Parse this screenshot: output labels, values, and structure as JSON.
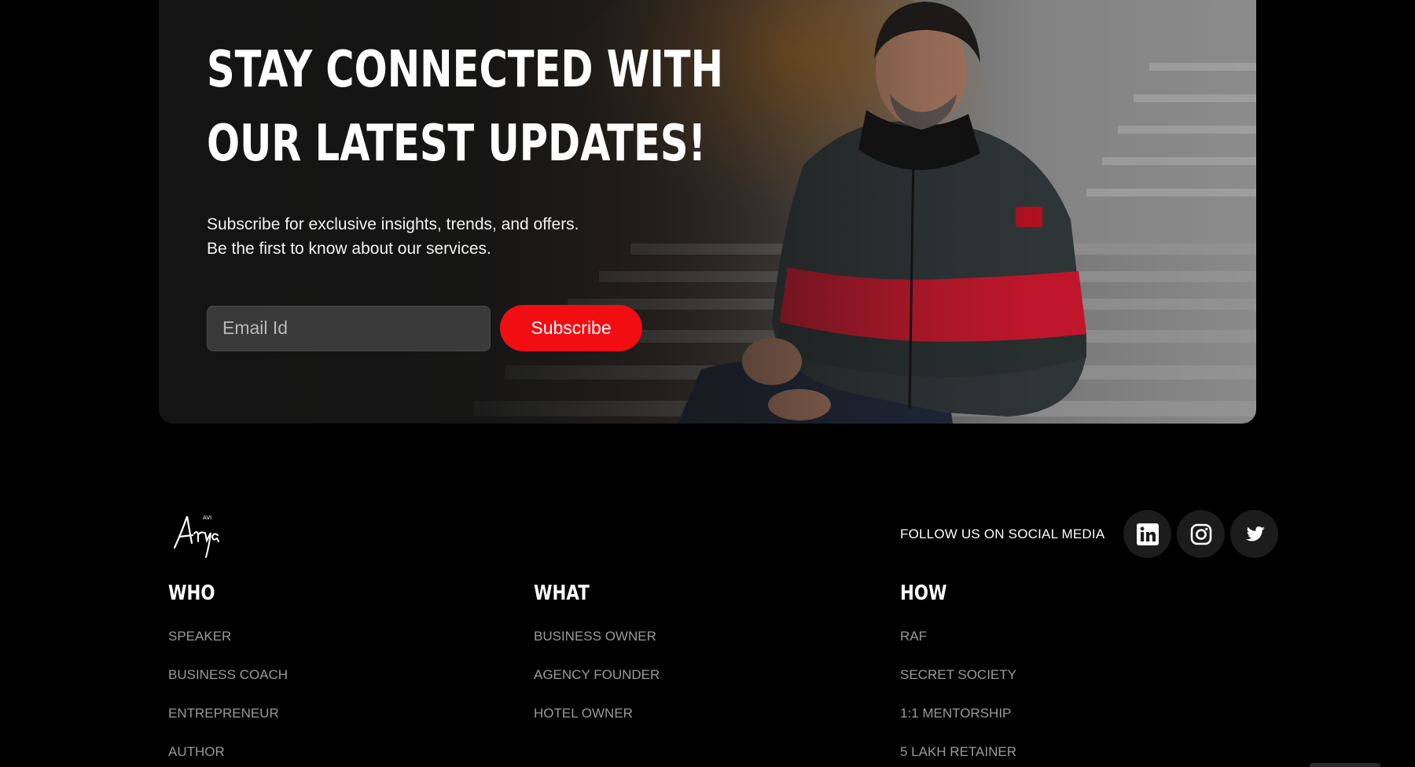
{
  "newsletter": {
    "title_line1": "STAY CONNECTED WITH",
    "title_line2": "OUR LATEST UPDATES!",
    "subtitle_line1": "Subscribe for exclusive insights, trends, and offers.",
    "subtitle_line2": "Be the first to know about our services.",
    "email_placeholder": "Email Id",
    "subscribe_label": "Subscribe",
    "accent_color": "#f20d13",
    "image": "man-in-puffer-jacket-seated-on-steps"
  },
  "footer": {
    "logo_text": "Arya",
    "social_label": "FOLLOW US ON SOCIAL MEDIA",
    "social_icons": [
      "linkedin-icon",
      "instagram-icon",
      "twitter-icon"
    ],
    "columns": [
      {
        "heading": "WHO",
        "items": [
          "SPEAKER",
          "BUSINESS COACH",
          "ENTREPRENEUR",
          "AUTHOR"
        ]
      },
      {
        "heading": "WHAT",
        "items": [
          "BUSINESS OWNER",
          "AGENCY FOUNDER",
          "HOTEL OWNER"
        ]
      },
      {
        "heading": "HOW",
        "items": [
          "RAF",
          "SECRET SOCIETY",
          "1:1 MENTORSHIP",
          "5 LAKH RETAINER"
        ]
      }
    ]
  }
}
